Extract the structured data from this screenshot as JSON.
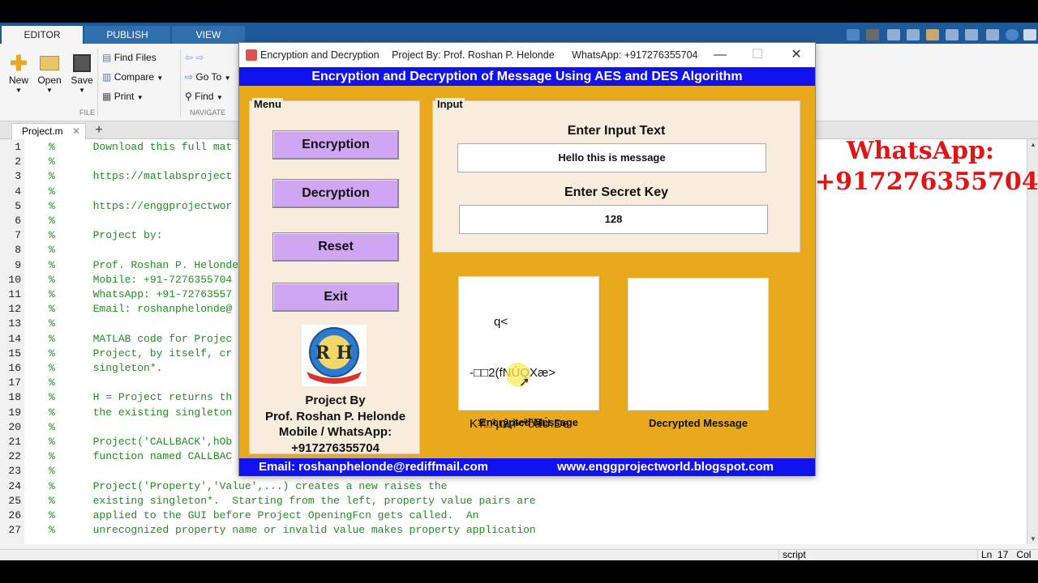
{
  "ribbon": {
    "tabs": [
      "EDITOR",
      "PUBLISH",
      "VIEW"
    ],
    "buttons": {
      "new": "New",
      "open": "Open",
      "save": "Save"
    },
    "small": {
      "find_files": "Find Files",
      "compare": "Compare",
      "print": "Print",
      "go_to": "Go To",
      "find": "Find"
    },
    "sections": {
      "file": "FILE",
      "navigate": "NAVIGATE"
    }
  },
  "editor": {
    "file_tab": "Project.m",
    "lines": [
      {
        "n": "1",
        "text": "%      Download this full mat"
      },
      {
        "n": "2",
        "text": "%"
      },
      {
        "n": "3",
        "text": "%      https://matlabsproject"
      },
      {
        "n": "4",
        "text": "%"
      },
      {
        "n": "5",
        "text": "%      https://enggprojectwor"
      },
      {
        "n": "6",
        "text": "%"
      },
      {
        "n": "7",
        "text": "%      Project by:"
      },
      {
        "n": "8",
        "text": "%"
      },
      {
        "n": "9",
        "text": "%      Prof. Roshan P. Helonde"
      },
      {
        "n": "10",
        "text": "%      Mobile: +91-7276355704"
      },
      {
        "n": "11",
        "text": "%      WhatsApp: +91-72763557"
      },
      {
        "n": "12",
        "text": "%      Email: roshanphelonde@"
      },
      {
        "n": "13",
        "text": "%"
      },
      {
        "n": "14",
        "text": "%      MATLAB code for Projec"
      },
      {
        "n": "15",
        "text": "%      Project, by itself, cr"
      },
      {
        "n": "16",
        "text": "%      singleton*."
      },
      {
        "n": "17",
        "text": "%"
      },
      {
        "n": "18",
        "text": "%      H = Project returns th"
      },
      {
        "n": "19",
        "text": "%      the existing singleton"
      },
      {
        "n": "20",
        "text": "%"
      },
      {
        "n": "21",
        "text": "%      Project('CALLBACK',hOb"
      },
      {
        "n": "22",
        "text": "%      function named CALLBAC"
      },
      {
        "n": "23",
        "text": "%"
      },
      {
        "n": "24",
        "text": "%      Project('Property','Value',...) creates a new raises the"
      },
      {
        "n": "25",
        "text": "%      existing singleton*.  Starting from the left, property value pairs are"
      },
      {
        "n": "26",
        "text": "%      applied to the GUI before Project OpeningFcn gets called.  An"
      },
      {
        "n": "27",
        "text": "%      unrecognized property name or invalid value makes property application"
      }
    ],
    "status": {
      "mode": "script",
      "ln": "Ln",
      "line": "17",
      "col": "Col"
    }
  },
  "overlay": {
    "whatsapp_label": "WhatsApp:",
    "whatsapp_number": "+917276355704"
  },
  "figure": {
    "window_title": "Encryption and Decryption",
    "window_by": "Project By: Prof. Roshan P. Helonde",
    "window_whatsapp": "WhatsApp: +917276355704",
    "banner": "Encryption and Decryption of Message Using AES and DES Algorithm",
    "menu": {
      "label": "Menu",
      "buttons": [
        "Encryption",
        "Decryption",
        "Reset",
        "Exit"
      ],
      "credit": [
        "Project By",
        "Prof. Roshan P. Helonde",
        "Mobile / WhatsApp:",
        "+917276355704"
      ]
    },
    "input": {
      "label": "Input",
      "text_heading": "Enter Input Text",
      "text_value": "Hello this is message",
      "key_heading": "Enter Secret Key",
      "key_value": "128"
    },
    "output": {
      "encrypted_lines": [
        "q<",
        "-□□2(fNÚQXæ>",
        "K¥□³µâ;ì<ªðâÚ.De"
      ],
      "encrypted_caption": "Encrypted Message",
      "decrypted_caption": "Decrypted Message"
    },
    "footer": {
      "email": "Email: roshanphelonde@rediffmail.com",
      "site": "www.enggprojectworld.blogspot.com"
    }
  },
  "colors": {
    "figure_bg": "#e8a91c",
    "banner": "#1212ee",
    "button": "#cfa6f2",
    "overlay_text": "#e01515"
  }
}
